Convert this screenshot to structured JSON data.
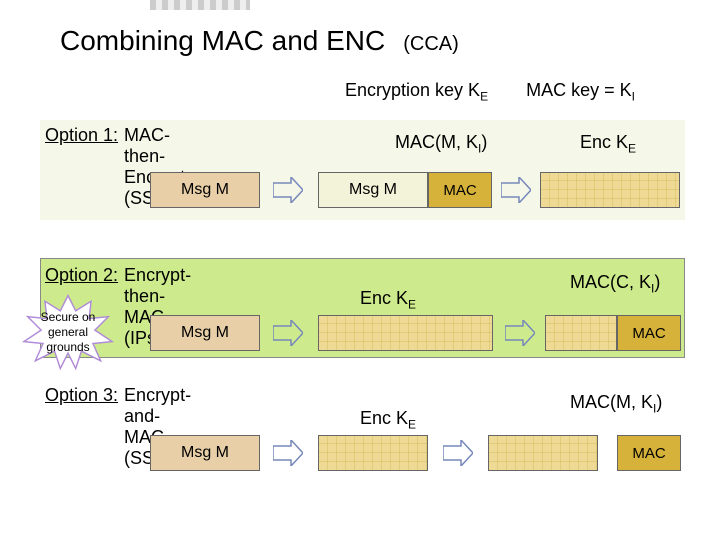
{
  "title": "Combining MAC and ENC",
  "cca": "(CCA)",
  "keys": {
    "enc": "Encryption key  K",
    "enc_sub": "E",
    "mac": "MAC key = K",
    "mac_sub": "I"
  },
  "options": {
    "o1": {
      "label": "Option 1:",
      "text": "MAC-then-Encrypt (SSL)"
    },
    "o2": {
      "label": "Option 2:",
      "text": "Encrypt-then-MAC (IPsec)"
    },
    "o3": {
      "label": "Option 3:",
      "text": "Encrypt-and-MAC (SSH)"
    }
  },
  "terms": {
    "msg_m": "Msg  M",
    "mac": "MAC",
    "macmki": "MAC(M, K",
    "macmki_sub": "I",
    "macmki_tail": ")",
    "maccki": "MAC(C, K",
    "maccki_sub": "I",
    "maccki_tail": ")",
    "encke": "Enc K",
    "encke_sub": "E"
  },
  "star": "Secure on general grounds"
}
